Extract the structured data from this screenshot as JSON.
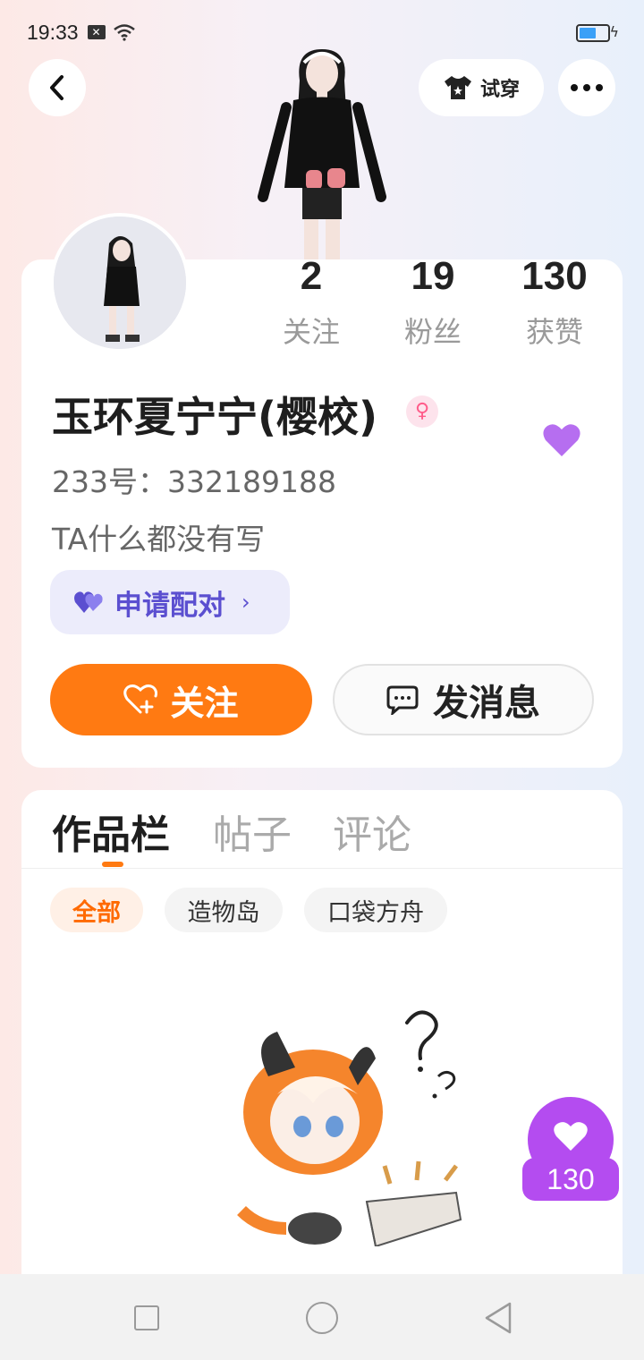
{
  "status_bar": {
    "time": "19:33",
    "battery_level": 0.6
  },
  "header": {
    "tryon_label": "试穿"
  },
  "profile": {
    "stats": [
      {
        "num": "2",
        "label": "关注"
      },
      {
        "num": "19",
        "label": "粉丝"
      },
      {
        "num": "130",
        "label": "获赞"
      }
    ],
    "username": "玉环夏宁宁(樱校)",
    "gender_symbol": "♀",
    "uid": "233号：332189188",
    "bio": "TA什么都没有写",
    "pair_label": "申请配对",
    "follow_label": "关注",
    "message_label": "发消息"
  },
  "content": {
    "tabs": [
      "作品栏",
      "帖子",
      "评论"
    ],
    "filters": [
      "全部",
      "造物岛",
      "口袋方舟"
    ]
  },
  "like_float": {
    "count": "130"
  },
  "colors": {
    "accent": "#ff7a12",
    "purple": "#b44cf0",
    "pair": "#5b4fd0"
  }
}
